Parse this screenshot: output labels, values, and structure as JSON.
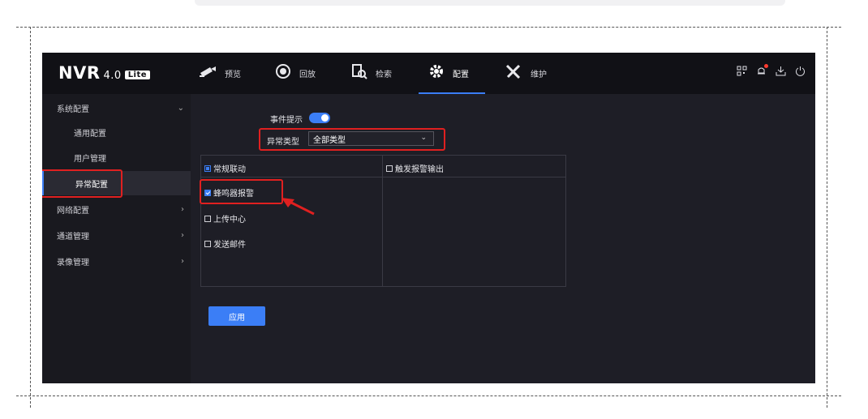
{
  "brand": {
    "name": "NVR",
    "version": "4.0",
    "edition": "Lite"
  },
  "nav": {
    "items": [
      {
        "label": "预览",
        "icon": "camera-icon"
      },
      {
        "label": "回放",
        "icon": "playback-icon"
      },
      {
        "label": "检索",
        "icon": "search-file-icon"
      },
      {
        "label": "配置",
        "icon": "gear-icon",
        "active": true
      },
      {
        "label": "维护",
        "icon": "tools-icon"
      }
    ],
    "right_icons": [
      "qr-code-icon",
      "bell-icon",
      "download-icon",
      "power-icon"
    ]
  },
  "sidebar": {
    "system_config": "系统配置",
    "general_config": "通用配置",
    "user_management": "用户管理",
    "exception_config": "异常配置",
    "network_config": "网络配置",
    "channel_management": "通道管理",
    "recording_management": "录像管理"
  },
  "form": {
    "event_hint_label": "事件提示",
    "event_hint_on": true,
    "exception_type_label": "异常类型",
    "exception_type_value": "全部类型"
  },
  "linkage": {
    "normal_linkage": {
      "label": "常规联动",
      "state": "partial"
    },
    "buzzer_alarm": {
      "label": "蜂鸣器报警",
      "checked": true
    },
    "upload_center": {
      "label": "上传中心",
      "checked": false
    },
    "send_email": {
      "label": "发送邮件",
      "checked": false
    },
    "trigger_alarm_output": {
      "label": "触发报警输出",
      "checked": false
    }
  },
  "apply_label": "应用",
  "colors": {
    "accent": "#3b7ef6",
    "highlight": "#e02020",
    "nav_bg": "#111116",
    "content_bg": "#1e1e26"
  }
}
